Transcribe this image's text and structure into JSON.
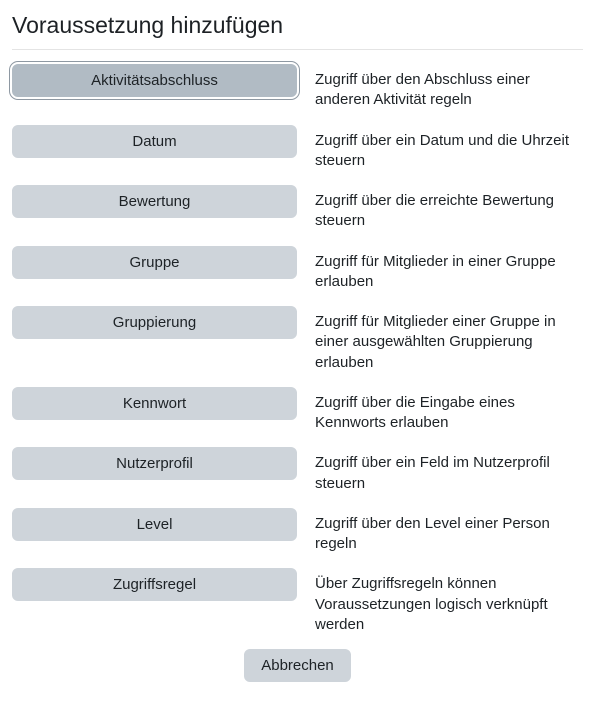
{
  "title": "Voraussetzung hinzufügen",
  "options": [
    {
      "label": "Aktivitätsabschluss",
      "desc": "Zugriff über den Abschluss einer anderen Aktivität regeln",
      "selected": true
    },
    {
      "label": "Datum",
      "desc": "Zugriff über ein Datum und die Uhrzeit steuern"
    },
    {
      "label": "Bewertung",
      "desc": "Zugriff über die erreichte Bewertung steuern"
    },
    {
      "label": "Gruppe",
      "desc": "Zugriff für Mitglieder in einer Gruppe erlauben"
    },
    {
      "label": "Gruppierung",
      "desc": "Zugriff für Mitglieder einer Gruppe in einer ausgewählten Gruppierung erlauben"
    },
    {
      "label": "Kennwort",
      "desc": "Zugriff über die Eingabe eines Kennworts erlauben"
    },
    {
      "label": "Nutzerprofil",
      "desc": "Zugriff über ein Feld im Nutzerprofil steuern"
    },
    {
      "label": "Level",
      "desc": "Zugriff über den Level einer Person regeln"
    },
    {
      "label": "Zugriffsregel",
      "desc": "Über Zugriffsregeln können Voraussetzungen logisch verknüpft werden"
    }
  ],
  "cancel_label": "Abbrechen"
}
